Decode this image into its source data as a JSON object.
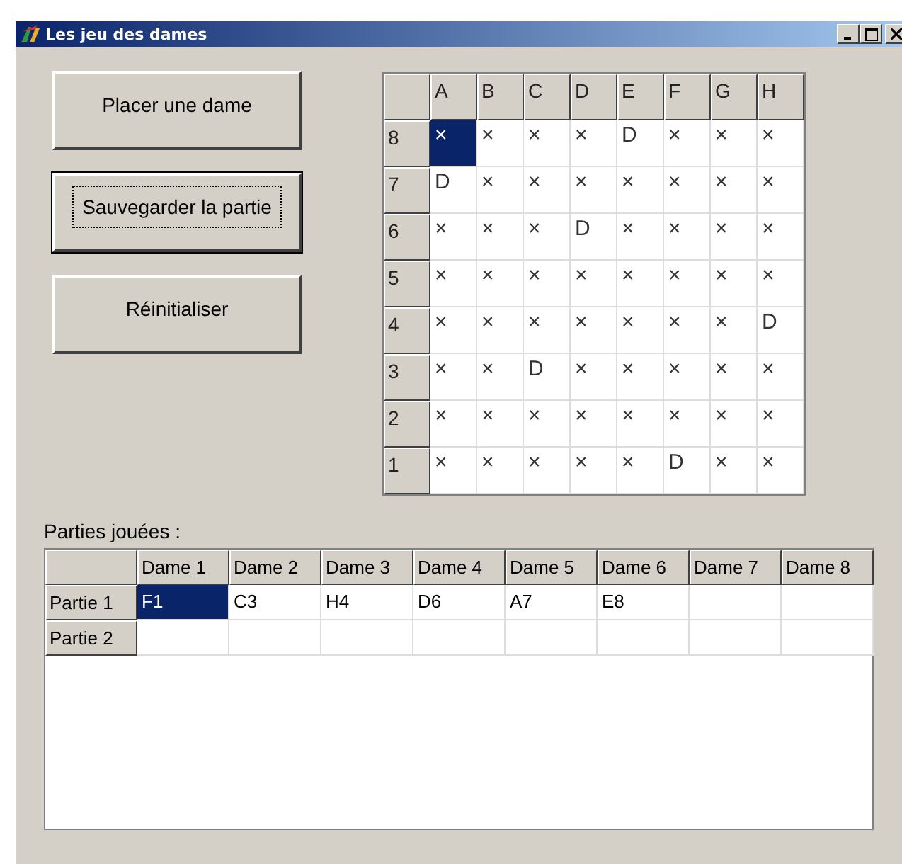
{
  "window": {
    "title": "Les jeu des dames"
  },
  "buttons": [
    {
      "label": "Placer une dame",
      "focused": false
    },
    {
      "label": "Sauvegarder la partie",
      "focused": true
    },
    {
      "label": "Réinitialiser",
      "focused": false
    }
  ],
  "board": {
    "columns": [
      "A",
      "B",
      "C",
      "D",
      "E",
      "F",
      "G",
      "H"
    ],
    "rows": [
      {
        "label": "8",
        "cells": [
          {
            "text": "×",
            "selected": true
          },
          {
            "text": "×",
            "selected": false
          },
          {
            "text": "×",
            "selected": false
          },
          {
            "text": "×",
            "selected": false
          },
          {
            "text": "D",
            "selected": false
          },
          {
            "text": "×",
            "selected": false
          },
          {
            "text": "×",
            "selected": false
          },
          {
            "text": "×",
            "selected": false
          }
        ]
      },
      {
        "label": "7",
        "cells": [
          {
            "text": "D",
            "selected": false
          },
          {
            "text": "×",
            "selected": false
          },
          {
            "text": "×",
            "selected": false
          },
          {
            "text": "×",
            "selected": false
          },
          {
            "text": "×",
            "selected": false
          },
          {
            "text": "×",
            "selected": false
          },
          {
            "text": "×",
            "selected": false
          },
          {
            "text": "×",
            "selected": false
          }
        ]
      },
      {
        "label": "6",
        "cells": [
          {
            "text": "×",
            "selected": false
          },
          {
            "text": "×",
            "selected": false
          },
          {
            "text": "×",
            "selected": false
          },
          {
            "text": "D",
            "selected": false
          },
          {
            "text": "×",
            "selected": false
          },
          {
            "text": "×",
            "selected": false
          },
          {
            "text": "×",
            "selected": false
          },
          {
            "text": "×",
            "selected": false
          }
        ]
      },
      {
        "label": "5",
        "cells": [
          {
            "text": "×",
            "selected": false
          },
          {
            "text": "×",
            "selected": false
          },
          {
            "text": "×",
            "selected": false
          },
          {
            "text": "×",
            "selected": false
          },
          {
            "text": "×",
            "selected": false
          },
          {
            "text": "×",
            "selected": false
          },
          {
            "text": "×",
            "selected": false
          },
          {
            "text": "×",
            "selected": false
          }
        ]
      },
      {
        "label": "4",
        "cells": [
          {
            "text": "×",
            "selected": false
          },
          {
            "text": "×",
            "selected": false
          },
          {
            "text": "×",
            "selected": false
          },
          {
            "text": "×",
            "selected": false
          },
          {
            "text": "×",
            "selected": false
          },
          {
            "text": "×",
            "selected": false
          },
          {
            "text": "×",
            "selected": false
          },
          {
            "text": "D",
            "selected": false
          }
        ]
      },
      {
        "label": "3",
        "cells": [
          {
            "text": "×",
            "selected": false
          },
          {
            "text": "×",
            "selected": false
          },
          {
            "text": "D",
            "selected": false
          },
          {
            "text": "×",
            "selected": false
          },
          {
            "text": "×",
            "selected": false
          },
          {
            "text": "×",
            "selected": false
          },
          {
            "text": "×",
            "selected": false
          },
          {
            "text": "×",
            "selected": false
          }
        ]
      },
      {
        "label": "2",
        "cells": [
          {
            "text": "×",
            "selected": false
          },
          {
            "text": "×",
            "selected": false
          },
          {
            "text": "×",
            "selected": false
          },
          {
            "text": "×",
            "selected": false
          },
          {
            "text": "×",
            "selected": false
          },
          {
            "text": "×",
            "selected": false
          },
          {
            "text": "×",
            "selected": false
          },
          {
            "text": "×",
            "selected": false
          }
        ]
      },
      {
        "label": "1",
        "cells": [
          {
            "text": "×",
            "selected": false
          },
          {
            "text": "×",
            "selected": false
          },
          {
            "text": "×",
            "selected": false
          },
          {
            "text": "×",
            "selected": false
          },
          {
            "text": "×",
            "selected": false
          },
          {
            "text": "D",
            "selected": false
          },
          {
            "text": "×",
            "selected": false
          },
          {
            "text": "×",
            "selected": false
          }
        ]
      }
    ]
  },
  "games": {
    "label": "Parties jouées :",
    "columns": [
      "Dame 1",
      "Dame 2",
      "Dame 3",
      "Dame 4",
      "Dame 5",
      "Dame 6",
      "Dame 7",
      "Dame 8"
    ],
    "rows": [
      {
        "label": "Partie 1",
        "cells": [
          {
            "text": "F1",
            "selected": true
          },
          {
            "text": "C3",
            "selected": false
          },
          {
            "text": "H4",
            "selected": false
          },
          {
            "text": "D6",
            "selected": false
          },
          {
            "text": "A7",
            "selected": false
          },
          {
            "text": "E8",
            "selected": false
          },
          {
            "selected": false
          },
          {
            "selected": false
          }
        ]
      },
      {
        "label": "Partie 2",
        "cells": [
          {
            "selected": false
          },
          {
            "selected": false
          },
          {
            "selected": false
          },
          {
            "selected": false
          },
          {
            "selected": false
          },
          {
            "selected": false
          },
          {
            "selected": false
          },
          {
            "selected": false
          }
        ]
      }
    ]
  }
}
